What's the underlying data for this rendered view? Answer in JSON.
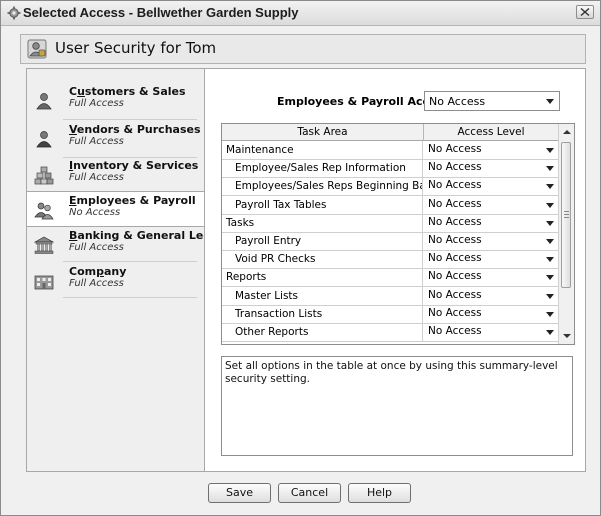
{
  "window": {
    "title": "Selected Access - Bellwether Garden Supply"
  },
  "header": {
    "title": "User Security for Tom"
  },
  "sidebar": {
    "items": [
      {
        "label": "Customers & Sales",
        "underline_char": "u",
        "access": "Full Access",
        "icon": "customers-icon"
      },
      {
        "label": "Vendors & Purchases",
        "underline_char": "V",
        "access": "Full Access",
        "icon": "vendors-icon"
      },
      {
        "label": "Inventory & Services",
        "underline_char": "I",
        "access": "Full Access",
        "icon": "inventory-icon"
      },
      {
        "label": "Employees & Payroll",
        "underline_char": "E",
        "access": "No Access",
        "icon": "employees-icon",
        "selected": true
      },
      {
        "label": "Banking & General Ledger",
        "underline_char": "B",
        "access": "Full Access",
        "icon": "bank-icon"
      },
      {
        "label": "Company",
        "underline_char": "p",
        "access": "Full Access",
        "icon": "company-icon"
      }
    ]
  },
  "main": {
    "summary_label": "Employees & Payroll Access:",
    "summary_value": "No Access",
    "table": {
      "headers": [
        "Task Area",
        "Access Level"
      ],
      "rows": [
        {
          "task": "Maintenance",
          "indent": false,
          "access": "No Access"
        },
        {
          "task": "Employee/Sales Rep Information",
          "indent": true,
          "access": "No Access"
        },
        {
          "task": "Employees/Sales Reps Beginning Balances",
          "indent": true,
          "access": "No Access"
        },
        {
          "task": "Payroll Tax Tables",
          "indent": true,
          "access": "No Access"
        },
        {
          "task": "Tasks",
          "indent": false,
          "access": "No Access"
        },
        {
          "task": "Payroll Entry",
          "indent": true,
          "access": "No Access"
        },
        {
          "task": "Void PR Checks",
          "indent": true,
          "access": "No Access"
        },
        {
          "task": "Reports",
          "indent": false,
          "access": "No Access"
        },
        {
          "task": "Master Lists",
          "indent": true,
          "access": "No Access"
        },
        {
          "task": "Transaction Lists",
          "indent": true,
          "access": "No Access"
        },
        {
          "task": "Other Reports",
          "indent": true,
          "access": "No Access"
        }
      ]
    },
    "description": "Set all options in the table at once by using this summary-level security setting."
  },
  "buttons": {
    "save": "Save",
    "cancel": "Cancel",
    "help": "Help"
  }
}
